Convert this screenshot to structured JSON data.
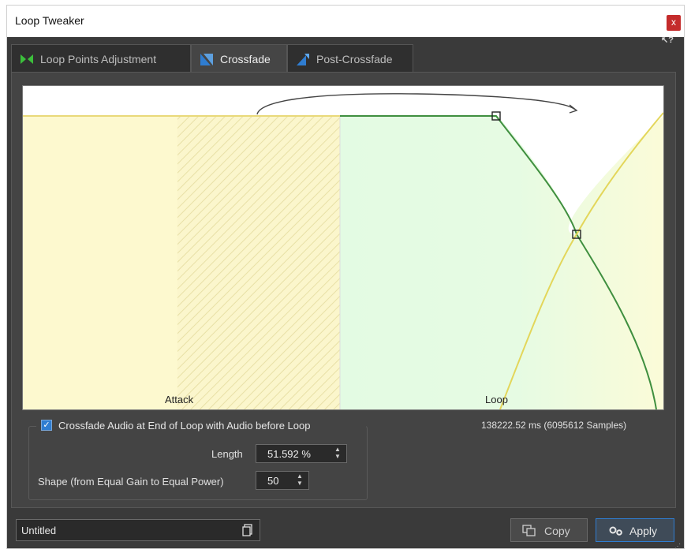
{
  "window": {
    "title": "Loop Tweaker",
    "close_label": "x"
  },
  "tabs": [
    {
      "label": "Loop Points Adjustment",
      "icon": "loop-points-icon",
      "active": false
    },
    {
      "label": "Crossfade",
      "icon": "crossfade-icon",
      "active": true
    },
    {
      "label": "Post-Crossfade",
      "icon": "post-crossfade-icon",
      "active": false
    }
  ],
  "graph": {
    "attack_label": "Attack",
    "loop_label": "Loop"
  },
  "crossfade": {
    "checkbox_label": "Crossfade Audio at End of Loop with Audio before Loop",
    "checked": true,
    "length_label": "Length",
    "length_value": "51.592 %",
    "shape_label": "Shape (from Equal Gain to Equal Power)",
    "shape_value": "50",
    "duration_text": "138222.52 ms (6095612 Samples)"
  },
  "footer": {
    "preset_name": "Untitled",
    "copy_label": "Copy",
    "apply_label": "Apply"
  },
  "colors": {
    "attack_fill": "#fdf9cf",
    "loop_fill": "#e3fbe3",
    "fade_out_curve": "#3f8f3f",
    "fade_in_curve": "#e3d65a",
    "accent": "#2f7dd1"
  }
}
